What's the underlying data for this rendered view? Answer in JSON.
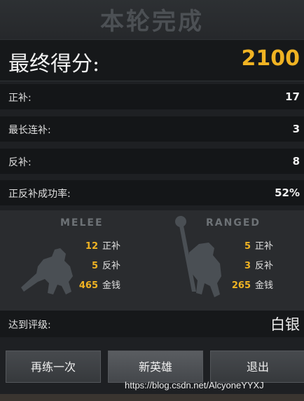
{
  "header": {
    "title": "本轮完成"
  },
  "final_score": {
    "label": "最终得分:",
    "value": "2100"
  },
  "stats": [
    {
      "label": "正补:",
      "value": "17"
    },
    {
      "label": "最长连补:",
      "value": "3"
    },
    {
      "label": "反补:",
      "value": "8"
    },
    {
      "label": "正反补成功率:",
      "value": "52%"
    }
  ],
  "melee": {
    "title": "MELEE",
    "rows": [
      {
        "value": "12",
        "label": "正补"
      },
      {
        "value": "5",
        "label": "反补"
      },
      {
        "value": "465",
        "label": "金钱"
      }
    ]
  },
  "ranged": {
    "title": "RANGED",
    "rows": [
      {
        "value": "5",
        "label": "正补"
      },
      {
        "value": "3",
        "label": "反补"
      },
      {
        "value": "265",
        "label": "金钱"
      }
    ]
  },
  "rank": {
    "label": "达到评级:",
    "value": "白银"
  },
  "buttons": {
    "retry": "再练一次",
    "new_hero": "新英雄",
    "exit": "退出"
  },
  "watermark": "https://blog.csdn.net/AlcyoneYYXJ",
  "colors": {
    "accent": "#f0b323",
    "background": "#1e2023",
    "silhouette": "#4a4f54"
  }
}
